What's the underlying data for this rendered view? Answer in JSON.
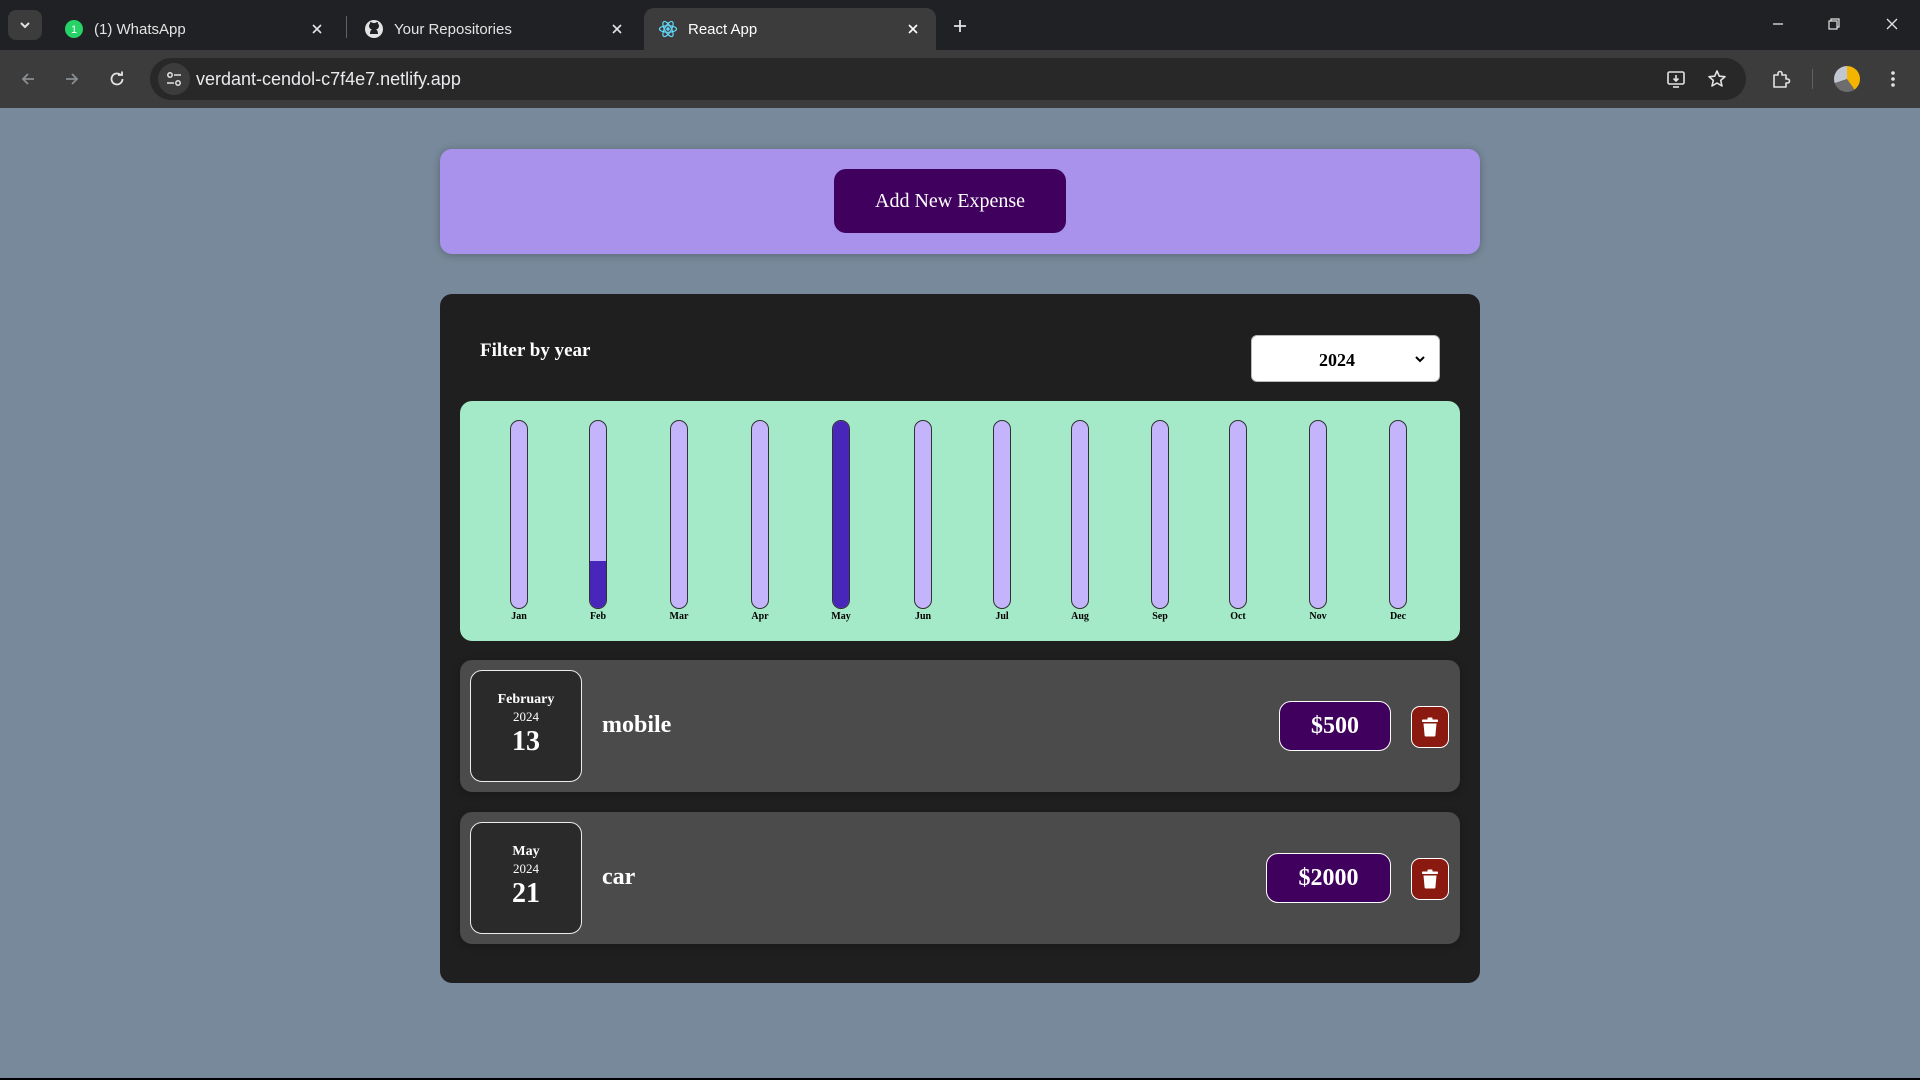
{
  "browser": {
    "tabs": [
      {
        "title": "(1) WhatsApp",
        "icon": "whatsapp-icon"
      },
      {
        "title": "Your Repositories",
        "icon": "github-icon"
      },
      {
        "title": "React App",
        "icon": "react-icon"
      }
    ],
    "active_tab": 2,
    "url": "verdant-cendol-c7f4e7.netlify.app"
  },
  "app": {
    "add_button_label": "Add New Expense",
    "filter": {
      "label": "Filter by year",
      "selected_year": "2024"
    },
    "chart_data": {
      "type": "bar",
      "categories": [
        "Jan",
        "Feb",
        "Mar",
        "Apr",
        "May",
        "Jun",
        "Jul",
        "Aug",
        "Sep",
        "Oct",
        "Nov",
        "Dec"
      ],
      "values": [
        0,
        500,
        0,
        0,
        2000,
        0,
        0,
        0,
        0,
        0,
        0,
        0
      ],
      "max": 2000,
      "colors": {
        "track": "#c3b4fc",
        "fill": "#4826b9",
        "background": "#a4e9c8"
      }
    },
    "expenses": [
      {
        "month": "February",
        "year": "2024",
        "day": "13",
        "title": "mobile",
        "amount": "$500"
      },
      {
        "month": "May",
        "year": "2024",
        "day": "21",
        "title": "car",
        "amount": "$2000"
      }
    ]
  }
}
